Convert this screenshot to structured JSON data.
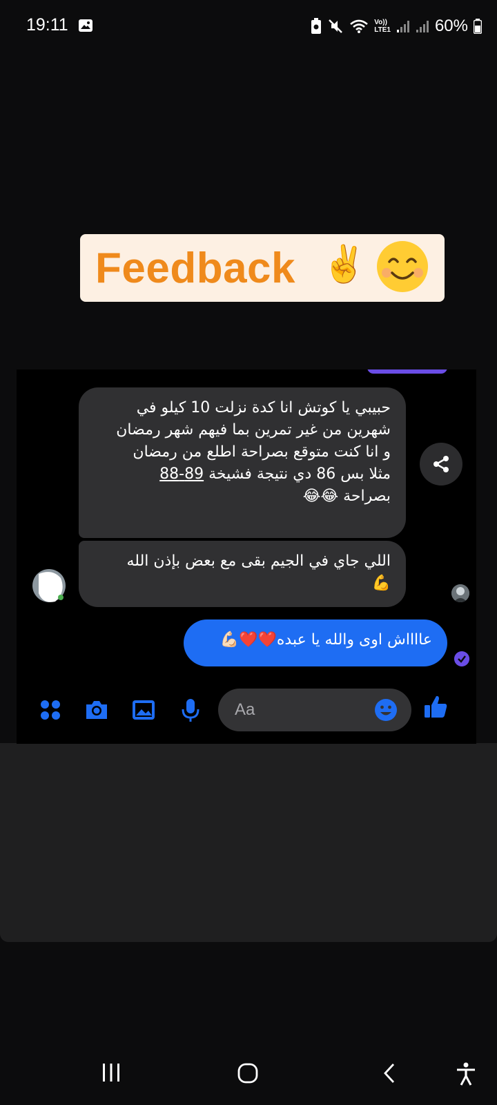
{
  "status_bar": {
    "time": "19:11",
    "network_label_top": "Vo))",
    "network_label_bottom": "LTE1",
    "battery": "60%"
  },
  "story": {
    "sticker_text": "Feedback",
    "sticker_emojis": [
      "✌️",
      "😊"
    ],
    "accent_color": "#ef8a1c"
  },
  "chat": {
    "messages": [
      {
        "lines": [
          "حبيبي يا كوتش انا كدة نزلت 10 كيلو في",
          "شهرين من غير تمرين بما فيهم شهر رمضان",
          "و انا كنت متوقع بصراحة اطلع من رمضان",
          "مثلا بس 86 دي نتيجة فشيخة",
          "بصراحة 😂😂"
        ],
        "underlined_value": "89-88"
      },
      {
        "lines": [
          "اللي جاي في الجيم بقى مع بعض بإذن الله",
          "💪"
        ]
      }
    ],
    "sent_message": "عااااش اوى والله يا عبده❤️❤️💪🏻",
    "composer_placeholder": "Aa",
    "sent_color": "#1e6df3"
  }
}
